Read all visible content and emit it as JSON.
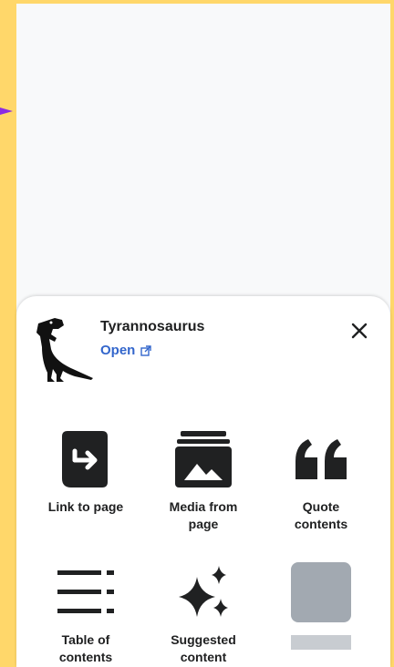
{
  "article": {
    "title": "Tyrannosaurus",
    "open_label": "Open"
  },
  "grid": [
    {
      "label": "Link to page",
      "icon": "link-to-page-icon"
    },
    {
      "label": "Media from\npage",
      "icon": "media-icon"
    },
    {
      "label": "Quote\ncontents",
      "icon": "quote-icon"
    },
    {
      "label": "Table of\ncontents",
      "icon": "table-of-contents-icon"
    },
    {
      "label": "Suggested\ncontent",
      "icon": "sparkle-icon"
    }
  ],
  "colors": {
    "accent": "#3366cc",
    "frame": "#ffd76a",
    "pointer": "#8a2be2",
    "text": "#202122"
  }
}
